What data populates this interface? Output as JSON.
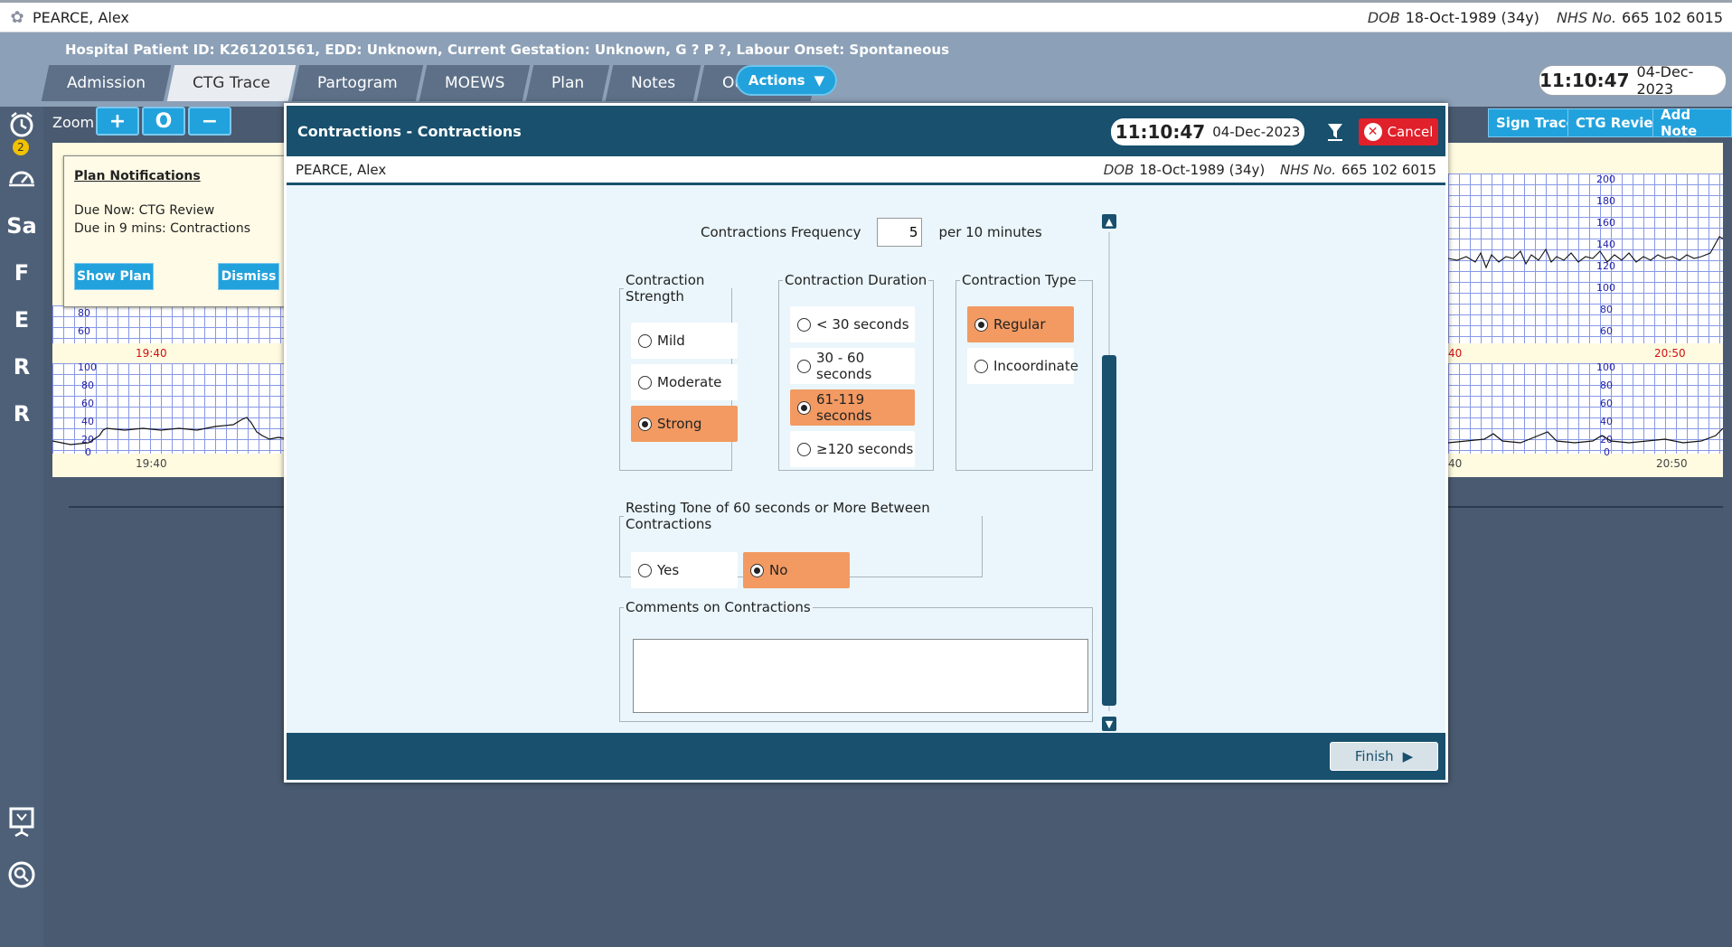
{
  "patient": {
    "name": "PEARCE, Alex",
    "dob_label": "DOB",
    "dob": "18-Oct-1989 (34y)",
    "nhs_label": "NHS No.",
    "nhs": "665 102 6015"
  },
  "header": {
    "info_line": "Hospital Patient ID: K261201561,    EDD: Unknown,    Current Gestation: Unknown, G ? P ?,    Labour Onset: Spontaneous",
    "tabs": [
      {
        "label": "Admission"
      },
      {
        "label": "CTG Trace",
        "active": true
      },
      {
        "label": "Partogram"
      },
      {
        "label": "MOEWS"
      },
      {
        "label": "Plan"
      },
      {
        "label": "Notes"
      },
      {
        "label": "Outcome"
      }
    ],
    "actions_label": "Actions",
    "time": "11:10:47",
    "date": "04-Dec-2023"
  },
  "sidebar": {
    "badge_count": "2",
    "letters": [
      "Sa",
      "F",
      "E",
      "R",
      "R"
    ]
  },
  "toolbar": {
    "zoom_label": "Zoom:",
    "zoom_in": "+",
    "zoom_reset": "O",
    "zoom_out": "−",
    "sign_trace": "Sign Trace",
    "ctg_review": "CTG Review",
    "add_note": "Add Note"
  },
  "trace": {
    "fhr_scale": [
      "200",
      "180",
      "160",
      "140",
      "120",
      "100",
      "80",
      "60"
    ],
    "toco_scale": [
      "100",
      "80",
      "60",
      "40",
      "20",
      "0"
    ],
    "left_time": "19:40",
    "right_time_1": "40",
    "right_time_2": "20:50"
  },
  "notification": {
    "title": "Plan Notifications",
    "line1": "Due Now: CTG Review",
    "line2": "Due in 9 mins: Contractions",
    "show_plan": "Show Plan",
    "dismiss": "Dismiss"
  },
  "modal": {
    "title": "Contractions -  Contractions",
    "time": "11:10:47",
    "date": "04-Dec-2023",
    "cancel_label": "Cancel",
    "frequency_label": "Contractions Frequency",
    "frequency_value": "5",
    "frequency_unit": "per 10 minutes",
    "strength": {
      "legend": "Contraction Strength",
      "options": [
        {
          "label": "Mild",
          "selected": false
        },
        {
          "label": "Moderate",
          "selected": false
        },
        {
          "label": "Strong",
          "selected": true
        }
      ]
    },
    "duration": {
      "legend": "Contraction Duration",
      "options": [
        {
          "label": "< 30 seconds",
          "selected": false
        },
        {
          "label": "30 - 60 seconds",
          "selected": false
        },
        {
          "label": "61-119 seconds",
          "selected": true
        },
        {
          "label": "≥120 seconds",
          "selected": false
        }
      ]
    },
    "type": {
      "legend": "Contraction Type",
      "options": [
        {
          "label": "Regular",
          "selected": true
        },
        {
          "label": "Incoordinate",
          "selected": false
        }
      ]
    },
    "resting_tone": {
      "legend": "Resting Tone of 60 seconds or More Between Contractions",
      "options": [
        {
          "label": "Yes",
          "selected": false
        },
        {
          "label": "No",
          "selected": true
        }
      ]
    },
    "comments_legend": "Comments on Contractions",
    "comments_value": "",
    "finish_label": "Finish"
  },
  "colors": {
    "accent": "#22a2dc",
    "modal_dark": "#18506d",
    "selected_option": "#f29a62",
    "cancel_red": "#e0202a"
  }
}
